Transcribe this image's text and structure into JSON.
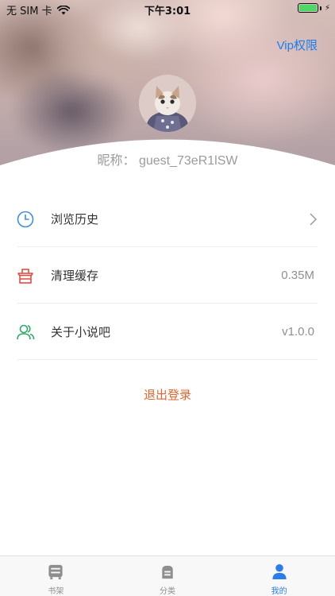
{
  "status_bar": {
    "carrier": "无 SIM 卡",
    "time": "下午3:01"
  },
  "header": {
    "vip_label": "Vip权限",
    "nickname": "昵称：  guest_73eR1lSW"
  },
  "menu": [
    {
      "label": "浏览历史",
      "icon": "clock-icon",
      "value": "",
      "has_chevron": true
    },
    {
      "label": "清理缓存",
      "icon": "basket-icon",
      "value": "0.35M",
      "has_chevron": false
    },
    {
      "label": "关于小说吧",
      "icon": "users-icon",
      "value": "v1.0.0",
      "has_chevron": false
    }
  ],
  "logout_label": "退出登录",
  "tabs": [
    {
      "label": "书架",
      "icon": "bookshelf-icon",
      "active": false
    },
    {
      "label": "分类",
      "icon": "category-icon",
      "active": false
    },
    {
      "label": "我的",
      "icon": "profile-icon",
      "active": true
    }
  ],
  "colors": {
    "accent": "#2b7de9",
    "vip": "#1b7ef0",
    "logout": "#e0642e",
    "history_icon": "#3d8fdd",
    "cache_icon": "#e0453a",
    "about_icon": "#2daa6a"
  }
}
